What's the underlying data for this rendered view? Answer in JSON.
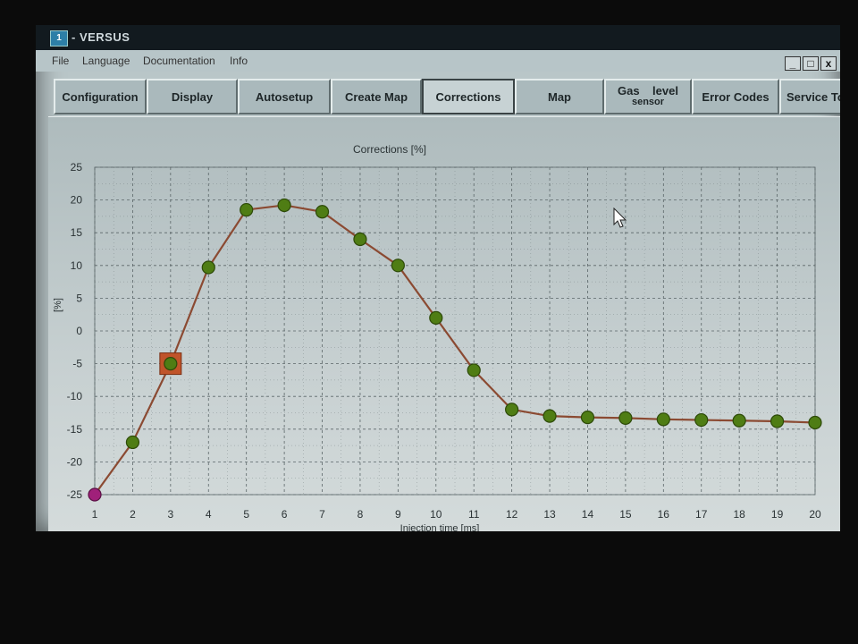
{
  "window": {
    "title": "- VERSUS",
    "icon": "app-logo-icon"
  },
  "menu": [
    "File",
    "Language",
    "Documentation",
    "Info"
  ],
  "window_controls": [
    "_",
    "□",
    "x"
  ],
  "tabs": [
    {
      "label": "Configuration"
    },
    {
      "label": "Display"
    },
    {
      "label": "Autosetup"
    },
    {
      "label": "Create Map"
    },
    {
      "label": "Corrections",
      "active": true
    },
    {
      "label": "Map"
    },
    {
      "label": "Gas    level",
      "sub": "sensor"
    },
    {
      "label": "Error Codes"
    },
    {
      "label": "Service To"
    }
  ],
  "colors": {
    "line": "#8b4a32",
    "point": "#4f7d14",
    "point_border": "#2d4a08",
    "selected_box": "#c0542a",
    "first_point": "#a0207a",
    "grid": "#5b6668"
  },
  "chart_data": {
    "type": "line",
    "title": "Corrections [%]",
    "xlabel": "Injection time [ms]",
    "ylabel": "[%]",
    "x": [
      1,
      2,
      3,
      4,
      5,
      6,
      7,
      8,
      9,
      10,
      11,
      12,
      13,
      14,
      15,
      16,
      17,
      18,
      19,
      20
    ],
    "y": [
      -25,
      -17,
      -5,
      9.7,
      18.5,
      19.2,
      18.2,
      14,
      10,
      2,
      -6,
      -12,
      -13,
      -13.2,
      -13.3,
      -13.5,
      -13.6,
      -13.7,
      -13.8,
      -14
    ],
    "xlim": [
      1,
      20
    ],
    "ylim": [
      -25,
      25
    ],
    "x_ticks": [
      1,
      2,
      3,
      4,
      5,
      6,
      7,
      8,
      9,
      10,
      11,
      12,
      13,
      14,
      15,
      16,
      17,
      18,
      19,
      20
    ],
    "y_ticks": [
      25,
      20,
      15,
      10,
      5,
      0,
      -5,
      -10,
      -15,
      -20,
      -25
    ],
    "selected_index": 2,
    "grid": true
  }
}
